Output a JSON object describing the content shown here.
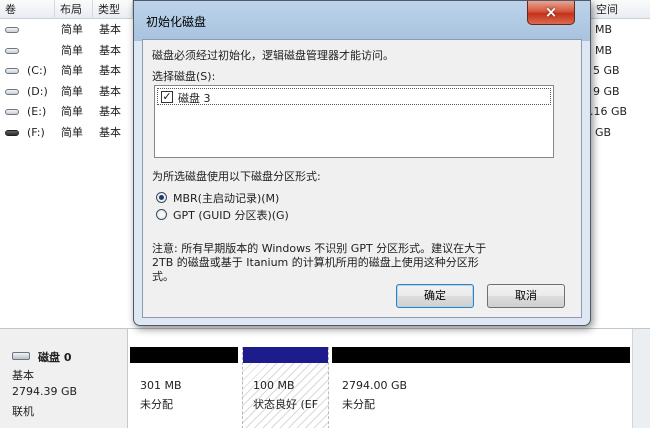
{
  "volume_table": {
    "headers": [
      "卷",
      "布局",
      "类型",
      "",
      "空间"
    ],
    "rows": [
      {
        "volume": "",
        "layout": "简单",
        "type": "基本",
        "free": "MB"
      },
      {
        "volume": "",
        "layout": "简单",
        "type": "基本",
        "free": "MB"
      },
      {
        "volume": "(C:)",
        "layout": "简单",
        "type": "基本",
        "free": "5 GB"
      },
      {
        "volume": "(D:)",
        "layout": "简单",
        "type": "基本",
        "free": "9 GB"
      },
      {
        "volume": "(E:)",
        "layout": "简单",
        "type": "基本",
        "free": ".16 GB"
      },
      {
        "volume": "(F:)",
        "layout": "简单",
        "type": "基本",
        "free": "GB"
      }
    ]
  },
  "dialog": {
    "title": "初始化磁盘",
    "close_label": "×",
    "intro": "磁盘必须经过初始化，逻辑磁盘管理器才能访问。",
    "select_label": "选择磁盘(S):",
    "disks": [
      {
        "label": "磁盘 3",
        "checked": true
      }
    ],
    "style_label": "为所选磁盘使用以下磁盘分区形式:",
    "options": [
      {
        "label": "MBR(主启动记录)(M)",
        "selected": true
      },
      {
        "label": "GPT (GUID 分区表)(G)",
        "selected": false
      }
    ],
    "note_line1": "注意: 所有早期版本的 Windows 不识别 GPT 分区形式。建议在大于",
    "note_line2": "2TB 的磁盘或基于 Itanium 的计算机所用的磁盘上使用这种分区形",
    "note_line3": "式。",
    "ok_label": "确定",
    "cancel_label": "取消"
  },
  "disk_map": {
    "name": "磁盘 0",
    "kind": "基本",
    "size": "2794.39 GB",
    "status": "联机",
    "partitions": [
      {
        "size": "301 MB",
        "status": "未分配"
      },
      {
        "size": "100 MB",
        "status": "状态良好 (EF"
      },
      {
        "size": "2794.00 GB",
        "status": "未分配"
      }
    ]
  },
  "colors": {
    "unallocated_bar": "#000000",
    "primary_bar": "#1c1c8c",
    "dialog_frame": "#bcd3ea",
    "close_button": "#c4311a"
  }
}
